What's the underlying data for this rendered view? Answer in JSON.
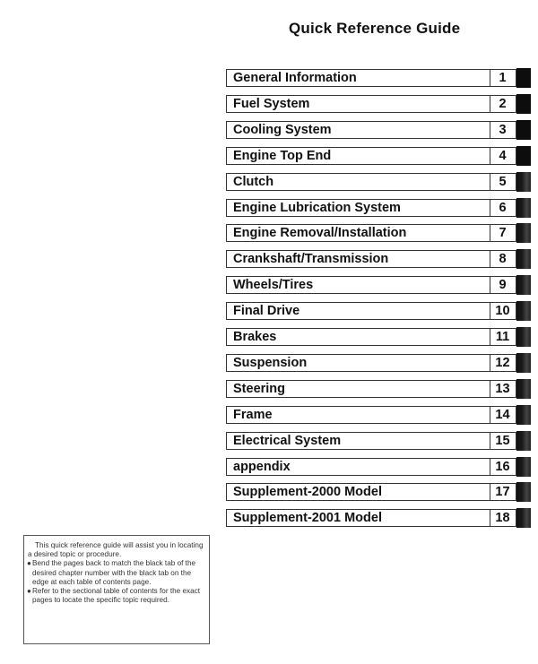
{
  "title": "Quick Reference Guide",
  "chapters": [
    {
      "label": "General Information",
      "number": "1"
    },
    {
      "label": "Fuel System",
      "number": "2"
    },
    {
      "label": "Cooling System",
      "number": "3"
    },
    {
      "label": "Engine Top End",
      "number": "4"
    },
    {
      "label": "Clutch",
      "number": "5"
    },
    {
      "label": "Engine Lubrication System",
      "number": "6"
    },
    {
      "label": "Engine Removal/Installation",
      "number": "7"
    },
    {
      "label": "Crankshaft/Transmission",
      "number": "8"
    },
    {
      "label": "Wheels/Tires",
      "number": "9"
    },
    {
      "label": "Final Drive",
      "number": "10"
    },
    {
      "label": "Brakes",
      "number": "11"
    },
    {
      "label": "Suspension",
      "number": "12"
    },
    {
      "label": "Steering",
      "number": "13"
    },
    {
      "label": "Frame",
      "number": "14"
    },
    {
      "label": "Electrical System",
      "number": "15"
    },
    {
      "label": "appendix",
      "number": "16"
    },
    {
      "label": "Supplement-2000 Model",
      "number": "17"
    },
    {
      "label": "Supplement-2001 Model",
      "number": "18"
    }
  ],
  "note": {
    "intro": "This quick reference guide will assist you in locating a desired topic or procedure.",
    "bullet_glyph": "●",
    "bullets": [
      "Bend the pages back to match the black tab of the desired chapter number with the black tab on the edge at each table of contents page.",
      "Refer to the sectional table of contents for the exact pages to locate the specific topic required."
    ]
  }
}
